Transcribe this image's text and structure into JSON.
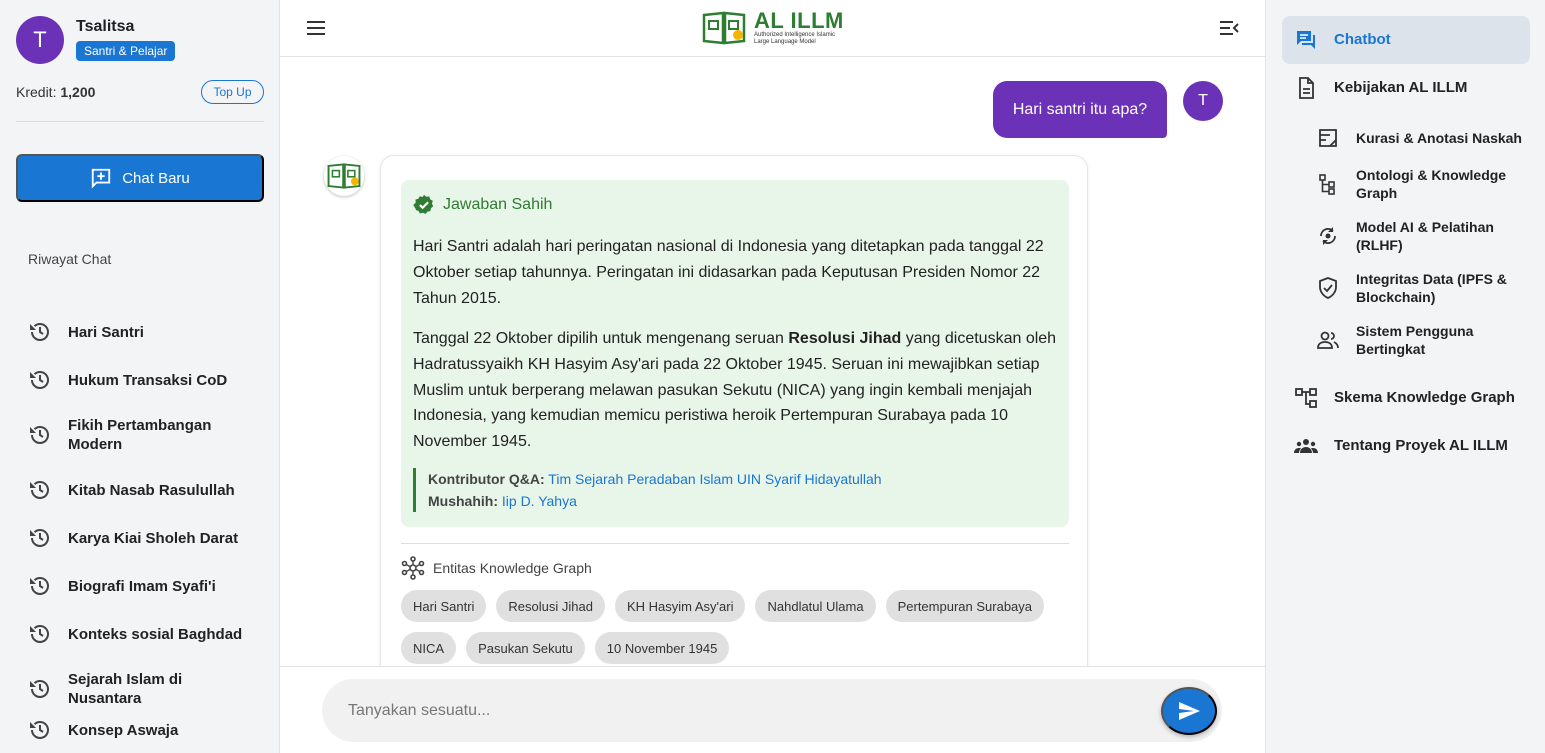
{
  "user": {
    "initial": "T",
    "name": "Tsalitsa",
    "role": "Santri & Pelajar",
    "credit_label": "Kredit:",
    "credit_value": "1,200",
    "topup_label": "Top Up"
  },
  "sidebar": {
    "new_chat_label": "Chat Baru",
    "history_title": "Riwayat Chat",
    "history": [
      "Hari Santri",
      "Hukum Transaksi CoD",
      "Fikih Pertambangan Modern",
      "Kitab Nasab Rasulullah",
      "Karya Kiai Sholeh Darat",
      "Biografi Imam Syafi'i",
      "Konteks sosial Baghdad",
      "Sejarah Islam di Nusantara",
      "Konsep Aswaja"
    ]
  },
  "header": {
    "logo_title": "AL ILLM",
    "logo_sub_1": "Authorized Intelligence Islamic",
    "logo_sub_2": "Large Language Model"
  },
  "chat": {
    "user_message": "Hari santri itu apa?",
    "answer_badge": "Jawaban Sahih",
    "para1": "Hari Santri adalah hari peringatan nasional di Indonesia yang ditetapkan pada tanggal 22 Oktober setiap tahunnya. Peringatan ini didasarkan pada Keputusan Presiden Nomor 22 Tahun 2015.",
    "para2_before": "Tanggal 22 Oktober dipilih untuk mengenang seruan ",
    "para2_bold": "Resolusi Jihad",
    "para2_after": " yang dicetuskan oleh Hadratussyaikh KH Hasyim Asy'ari pada 22 Oktober 1945. Seruan ini mewajibkan setiap Muslim untuk berperang melawan pasukan Sekutu (NICA) yang ingin kembali menjajah Indonesia, yang kemudian memicu peristiwa heroik Pertempuran Surabaya pada 10 November 1945.",
    "contributor_label": "Kontributor Q&A:",
    "contributor_value": "Tim Sejarah Peradaban Islam UIN Syarif Hidayatullah",
    "mushahih_label": "Mushahih:",
    "mushahih_value": "Iip D. Yahya",
    "kg_title": "Entitas Knowledge Graph",
    "entities": [
      "Hari Santri",
      "Resolusi Jihad",
      "KH Hasyim Asy'ari",
      "Nahdlatul Ulama",
      "Pertempuran Surabaya",
      "NICA",
      "Pasukan Sekutu",
      "10 November 1945"
    ]
  },
  "composer": {
    "placeholder": "Tanyakan sesuatu..."
  },
  "rightnav": {
    "chatbot": "Chatbot",
    "kebijakan": "Kebijakan AL ILLM",
    "sub": [
      "Kurasi & Anotasi Naskah",
      "Ontologi & Knowledge Graph",
      "Model AI & Pelatihan (RLHF)",
      "Integritas Data (IPFS & Blockchain)",
      "Sistem Pengguna Bertingkat"
    ],
    "skema": "Skema Knowledge Graph",
    "tentang": "Tentang Proyek AL ILLM"
  },
  "colors": {
    "primary": "#1976d2",
    "purple": "#6b32b7",
    "green": "#2e7d32",
    "answer_bg": "#e8f5e9"
  }
}
